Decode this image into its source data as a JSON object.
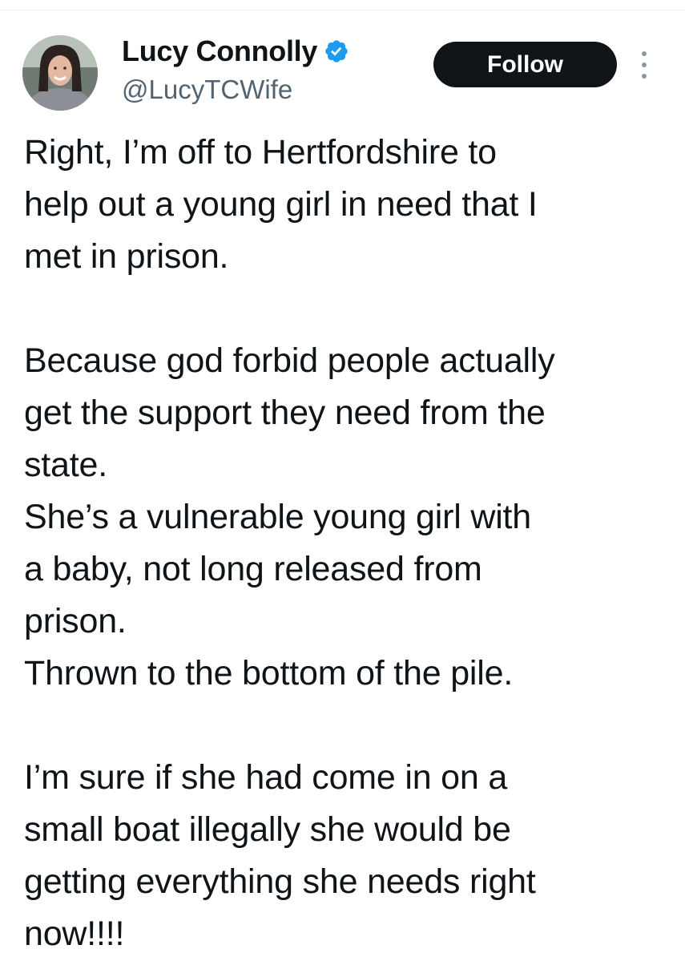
{
  "author": {
    "display_name": "Lucy Connolly",
    "handle": "@LucyTCWife",
    "verified": true,
    "avatar_icon": "profile-photo"
  },
  "actions": {
    "follow_label": "Follow",
    "more_icon": "more-vertical-icon"
  },
  "colors": {
    "verified_badge": "#1d9bf0",
    "follow_button_bg": "#0f1419",
    "handle_text": "#536471",
    "body_text": "#0f1419"
  },
  "tweet": {
    "lines": [
      "Right, I’m off to Hertfordshire to",
      "help out a young girl in need that I",
      "met in prison.",
      "",
      "Because god forbid people actually",
      "get the support they need from the",
      "state.",
      "She’s a vulnerable young girl with",
      "a baby, not long released from",
      "prison.",
      "Thrown to the bottom of the pile.",
      "",
      "I’m sure if she had come in on a",
      "small boat illegally she would be",
      "getting everything she needs right",
      "now!!!!"
    ]
  }
}
